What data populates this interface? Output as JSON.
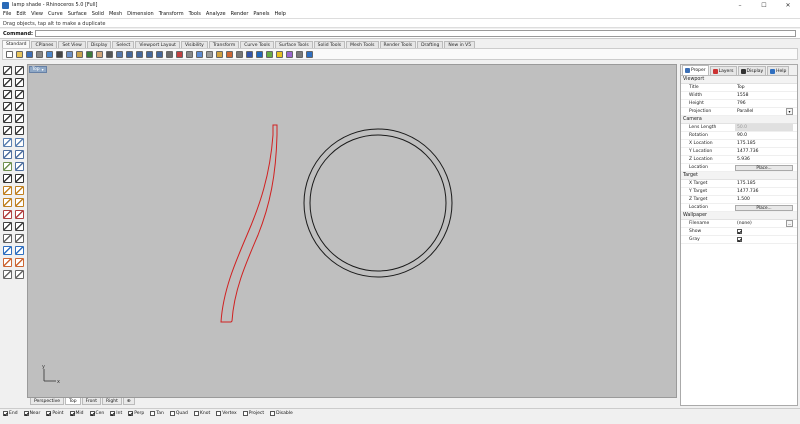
{
  "window": {
    "title": "lamp shade - Rhinoceros 5.0 [Full]",
    "controls": [
      "–",
      "☐",
      "✕"
    ]
  },
  "menu": [
    "File",
    "Edit",
    "View",
    "Curve",
    "Surface",
    "Solid",
    "Mesh",
    "Dimension",
    "Transform",
    "Tools",
    "Analyze",
    "Render",
    "Panels",
    "Help"
  ],
  "command": {
    "history": "Drag objects, tap alt to make a duplicate",
    "label": "Command:",
    "value": ""
  },
  "toolbar_tabs": [
    "Standard",
    "CPlanes",
    "Set View",
    "Display",
    "Select",
    "Viewport Layout",
    "Visibility",
    "Transform",
    "Curve Tools",
    "Surface Tools",
    "Solid Tools",
    "Mesh Tools",
    "Render Tools",
    "Drafting",
    "New in V5"
  ],
  "toolbar_icons": [
    {
      "name": "new-file-icon",
      "color": "#ffffff"
    },
    {
      "name": "open-icon",
      "color": "#e8c45a"
    },
    {
      "name": "save-icon",
      "color": "#3f6fb5"
    },
    {
      "name": "print-icon",
      "color": "#888888"
    },
    {
      "name": "import-icon",
      "color": "#4d86c9"
    },
    {
      "name": "cut-icon",
      "color": "#444444"
    },
    {
      "name": "copy-icon",
      "color": "#6b8fc4"
    },
    {
      "name": "paste-icon",
      "color": "#c9a24d"
    },
    {
      "name": "undo-icon",
      "color": "#3a7a3a"
    },
    {
      "name": "pan-icon",
      "color": "#d2a679"
    },
    {
      "name": "move-icon",
      "color": "#555555"
    },
    {
      "name": "rotate-view-icon",
      "color": "#5577aa"
    },
    {
      "name": "zoom-icon",
      "color": "#446699"
    },
    {
      "name": "zoom-window-icon",
      "color": "#446699"
    },
    {
      "name": "zoom-extents-icon",
      "color": "#446699"
    },
    {
      "name": "zoom-selected-icon",
      "color": "#446699"
    },
    {
      "name": "undo-view-icon",
      "color": "#6a6a6a"
    },
    {
      "name": "select-icon",
      "color": "#c04040"
    },
    {
      "name": "grid-icon",
      "color": "#888888"
    },
    {
      "name": "4-views-icon",
      "color": "#5c8ad0"
    },
    {
      "name": "wireframe-icon",
      "color": "#999999"
    },
    {
      "name": "shaded-icon",
      "color": "#d0a040"
    },
    {
      "name": "rendered-icon",
      "color": "#cc6633"
    },
    {
      "name": "ghosted-icon",
      "color": "#777777"
    },
    {
      "name": "xray-icon",
      "color": "#3355aa"
    },
    {
      "name": "sphere-icon",
      "color": "#2266bb"
    },
    {
      "name": "layer-icon",
      "color": "#66aa44"
    },
    {
      "name": "light-icon",
      "color": "#e8c020"
    },
    {
      "name": "object-properties-icon",
      "color": "#9966cc"
    },
    {
      "name": "options-icon",
      "color": "#7a7a7a"
    },
    {
      "name": "help-icon",
      "color": "#2f6fc0"
    }
  ],
  "left_toolbox": [
    {
      "name": "select-arrow-icon",
      "color": "#444444"
    },
    {
      "name": "point-icon",
      "color": "#444444"
    },
    {
      "name": "polyline-icon",
      "color": "#3a3a3a"
    },
    {
      "name": "curve-icon",
      "color": "#3a3a3a"
    },
    {
      "name": "circle-icon",
      "color": "#3a3a3a"
    },
    {
      "name": "arc-icon",
      "color": "#3a3a3a"
    },
    {
      "name": "rectangle-icon",
      "color": "#3a3a3a"
    },
    {
      "name": "polygon-icon",
      "color": "#3a3a3a"
    },
    {
      "name": "ellipse-icon",
      "color": "#3a3a3a"
    },
    {
      "name": "free-form-icon",
      "color": "#3a3a3a"
    },
    {
      "name": "fillet-icon",
      "color": "#3a3a3a"
    },
    {
      "name": "offset-icon",
      "color": "#3a3a3a"
    },
    {
      "name": "surface-icon",
      "color": "#5a7fb0"
    },
    {
      "name": "extrude-icon",
      "color": "#5a7fb0"
    },
    {
      "name": "box-icon",
      "color": "#4f6f9f"
    },
    {
      "name": "cylinder-icon",
      "color": "#4f6f9f"
    },
    {
      "name": "mesh-icon",
      "color": "#6f8f4f"
    },
    {
      "name": "boolean-icon",
      "color": "#4f6f9f"
    },
    {
      "name": "text-icon",
      "color": "#333333"
    },
    {
      "name": "dimension-icon",
      "color": "#333333"
    },
    {
      "name": "transform-icon",
      "color": "#c08020"
    },
    {
      "name": "scale-icon",
      "color": "#c08020"
    },
    {
      "name": "array-icon",
      "color": "#c08020"
    },
    {
      "name": "mirror-icon",
      "color": "#c08020"
    },
    {
      "name": "trim-icon",
      "color": "#b04040"
    },
    {
      "name": "split-icon",
      "color": "#b04040"
    },
    {
      "name": "join-icon",
      "color": "#404040"
    },
    {
      "name": "explode-icon",
      "color": "#404040"
    },
    {
      "name": "group-icon",
      "color": "#606060"
    },
    {
      "name": "block-icon",
      "color": "#606060"
    },
    {
      "name": "analyze-icon",
      "color": "#2f6fc0"
    },
    {
      "name": "check-icon",
      "color": "#2f6fc0"
    },
    {
      "name": "render-icon",
      "color": "#cc6633"
    },
    {
      "name": "material-icon",
      "color": "#cc6633"
    },
    {
      "name": "hide-icon",
      "color": "#666666"
    },
    {
      "name": "lock-icon",
      "color": "#666666"
    }
  ],
  "viewport": {
    "title": "Top",
    "background": "#bfbfbf"
  },
  "view_tabs": [
    "Perspective",
    "Top",
    "Front",
    "Right",
    "⊕"
  ],
  "view_tab_active": "Top",
  "osnap": [
    {
      "label": "End",
      "checked": true
    },
    {
      "label": "Near",
      "checked": true
    },
    {
      "label": "Point",
      "checked": true
    },
    {
      "label": "Mid",
      "checked": true
    },
    {
      "label": "Cen",
      "checked": true
    },
    {
      "label": "Int",
      "checked": true
    },
    {
      "label": "Perp",
      "checked": true
    },
    {
      "label": "Tan",
      "checked": false
    },
    {
      "label": "Quad",
      "checked": false
    },
    {
      "label": "Knot",
      "checked": false
    },
    {
      "label": "Vertex",
      "checked": false
    },
    {
      "label": "Project",
      "checked": false
    },
    {
      "label": "Disable",
      "checked": false
    }
  ],
  "panel": {
    "tabs": [
      {
        "label": "Proper",
        "icon": "properties-icon",
        "color": "#3b6fb6"
      },
      {
        "label": "Layers",
        "icon": "layers-icon",
        "color": "#cc3333"
      },
      {
        "label": "Display",
        "icon": "display-icon",
        "color": "#333333"
      },
      {
        "label": "Help",
        "icon": "help-icon",
        "color": "#2f6fc0"
      }
    ],
    "viewport_header": "Viewport",
    "viewport_rows": [
      {
        "label": "Title",
        "value": "Top"
      },
      {
        "label": "Width",
        "value": "1558"
      },
      {
        "label": "Height",
        "value": "796"
      },
      {
        "label": "Projection",
        "value": "Parallel"
      }
    ],
    "camera_header": "Camera",
    "camera_rows": [
      {
        "label": "Lens Length",
        "value": "50.0"
      },
      {
        "label": "Rotation",
        "value": "90.0"
      },
      {
        "label": "X Location",
        "value": "175.185"
      },
      {
        "label": "Y Location",
        "value": "1477.736"
      },
      {
        "label": "Z Location",
        "value": "5.936"
      },
      {
        "label": "Location",
        "value": "Place..."
      }
    ],
    "target_header": "Target",
    "target_rows": [
      {
        "label": "X Target",
        "value": "175.185"
      },
      {
        "label": "Y Target",
        "value": "1477.736"
      },
      {
        "label": "Z Target",
        "value": "1.500"
      },
      {
        "label": "Location",
        "value": "Place..."
      }
    ],
    "wallpaper_header": "Wallpaper",
    "wallpaper_rows": [
      {
        "label": "Filename",
        "value": "(none)"
      },
      {
        "label": "Show",
        "value": ""
      },
      {
        "label": "Gray",
        "value": ""
      }
    ],
    "ellipsis": "...",
    "dropdown": "▾"
  },
  "colors": {
    "selected_curve": "#d02020",
    "circle": "#1a1a1a",
    "viewport_bg": "#bfbfbf"
  }
}
